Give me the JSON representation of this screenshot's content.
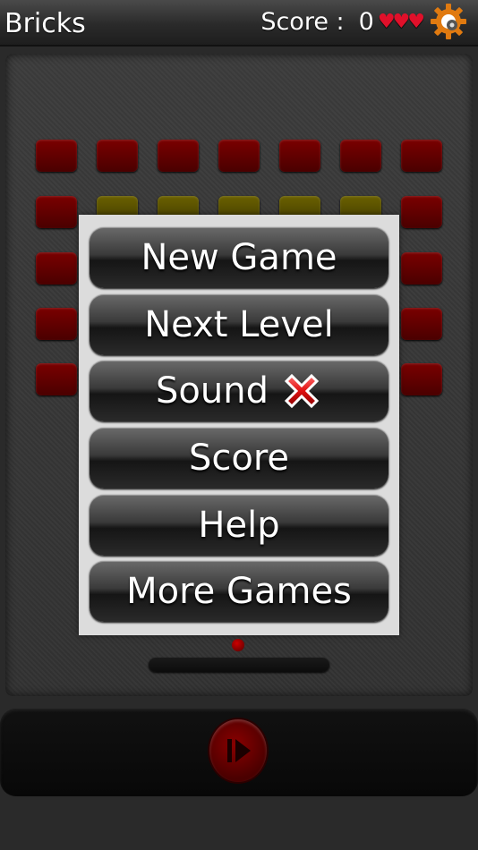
{
  "header": {
    "title": "Bricks",
    "score_label": "Score :",
    "score_value": "0",
    "lives": "♥♥♥",
    "settings_icon": "gear-icon"
  },
  "menu": {
    "items": [
      {
        "label": "New Game"
      },
      {
        "label": "Next Level"
      },
      {
        "label": "Sound",
        "icon": "x-icon",
        "state": "off"
      },
      {
        "label": "Score"
      },
      {
        "label": "Help"
      },
      {
        "label": "More Games"
      }
    ]
  },
  "controls": {
    "play_icon": "play-pause-icon"
  },
  "colors": {
    "brick_red": "#6a0000",
    "brick_yellow": "#5a5200",
    "heart": "#e0102a",
    "menu_bg": "#dcdcdc"
  }
}
